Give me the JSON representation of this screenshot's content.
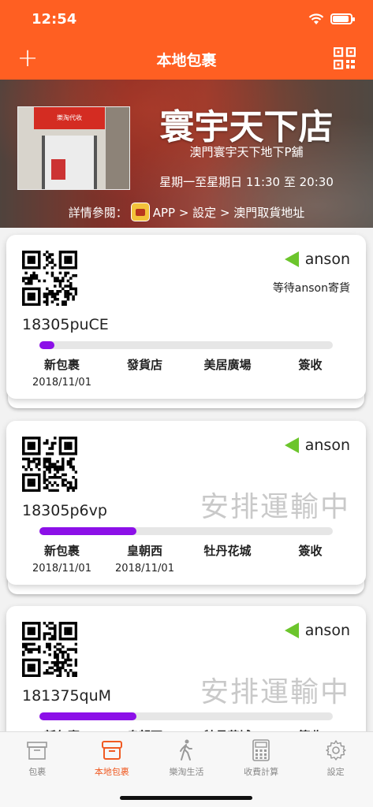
{
  "status_bar": {
    "time": "12:54"
  },
  "nav": {
    "title": "本地包裹",
    "add_symbol": "+"
  },
  "banner": {
    "store_name": "寰宇天下店",
    "subtitle": "澳門寰宇天下地下P舖",
    "hours": "星期一至星期日 11:30 至 20:30",
    "details_prefix": "詳情參閱：",
    "details_path": "APP > 設定 > 澳門取貨地址",
    "photo_sign": "樂淘代收"
  },
  "cards": [
    {
      "owner": "anson",
      "status_text": "等待anson寄貨",
      "big_status": "",
      "tracking": "18305puCE",
      "progress": 0.05,
      "stages": [
        "新包裹",
        "發貨店",
        "美居廣場",
        "簽收"
      ],
      "dates": [
        "2018/11/01",
        "",
        "",
        ""
      ]
    },
    {
      "owner": "anson",
      "status_text": "",
      "big_status": "安排運輸中",
      "tracking": "18305p6vp",
      "progress": 0.33,
      "stages": [
        "新包裹",
        "皇朝西",
        "牡丹花城",
        "簽收"
      ],
      "dates": [
        "2018/11/01",
        "2018/11/01",
        "",
        ""
      ]
    },
    {
      "owner": "anson",
      "status_text": "",
      "big_status": "安排運輸中",
      "tracking": "181375quM",
      "progress": 0.33,
      "stages": [
        "新包裹",
        "皇朝西",
        "牡丹花城",
        "簽收"
      ],
      "dates": [
        "",
        "",
        "",
        ""
      ]
    }
  ],
  "tabbar": {
    "items": [
      {
        "label": "包裹",
        "icon": "box-icon"
      },
      {
        "label": "本地包裹",
        "icon": "local-box-icon"
      },
      {
        "label": "樂淘生活",
        "icon": "walking-icon"
      },
      {
        "label": "收費計算",
        "icon": "calculator-icon"
      },
      {
        "label": "設定",
        "icon": "gear-icon"
      }
    ],
    "active_index": 1
  },
  "colors": {
    "accent": "#ff5f22",
    "progress": "#8c10e8",
    "owner_marker": "#6cc52c"
  }
}
